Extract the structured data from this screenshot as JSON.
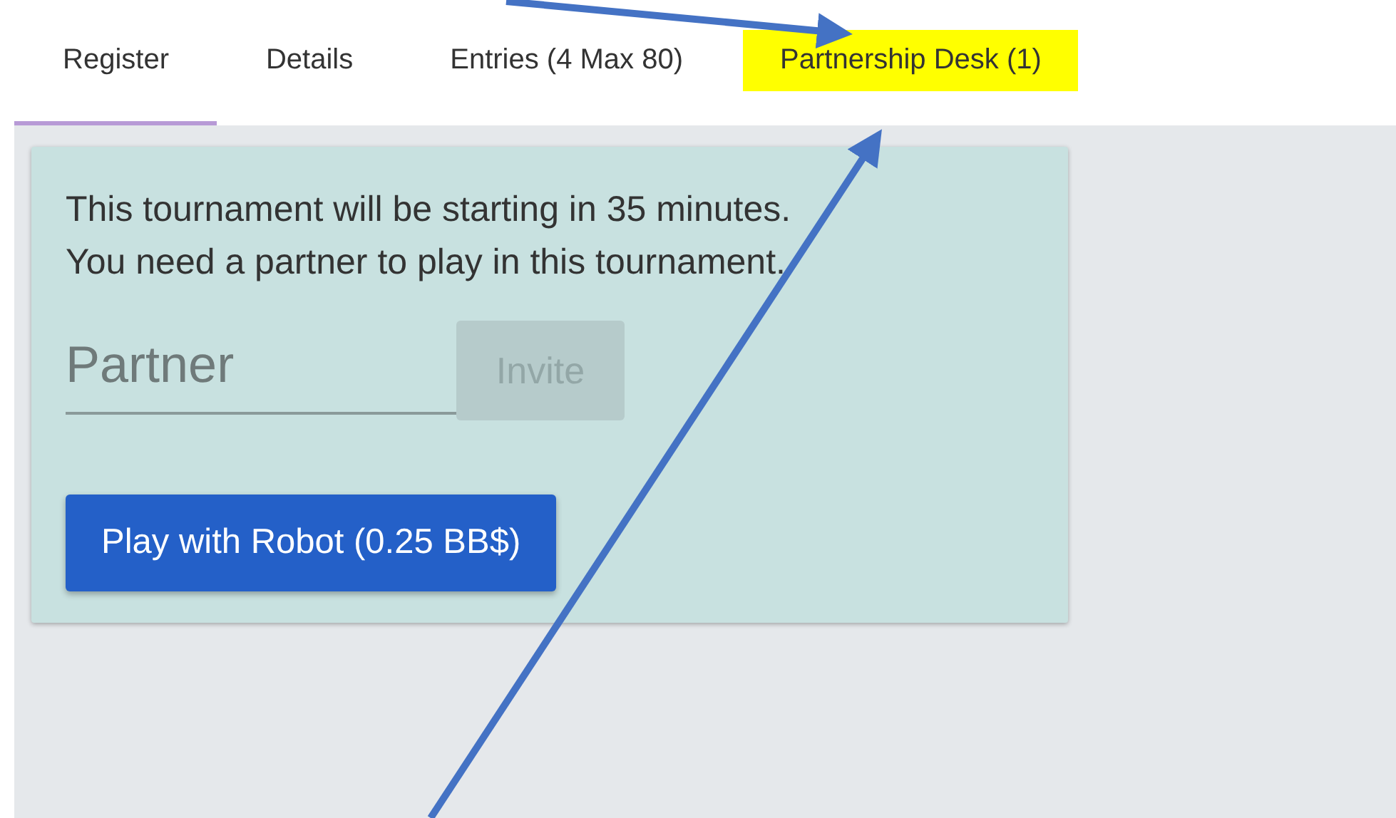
{
  "tabs": [
    {
      "label": "Register",
      "selected": true,
      "highlighted": false
    },
    {
      "label": "Details",
      "selected": false,
      "highlighted": false
    },
    {
      "label": "Entries (4 Max 80)",
      "selected": false,
      "highlighted": false
    },
    {
      "label": "Partnership Desk (1)",
      "selected": false,
      "highlighted": true
    }
  ],
  "card": {
    "message": [
      "This tournament will be starting in 35 minutes.",
      "You need a partner to play in this tournament."
    ],
    "partner_field": {
      "placeholder": "Partner"
    },
    "invite_button": {
      "label": "Invite",
      "disabled": true
    },
    "robot_button": {
      "label": "Play with Robot (0.25 BB$)"
    }
  }
}
